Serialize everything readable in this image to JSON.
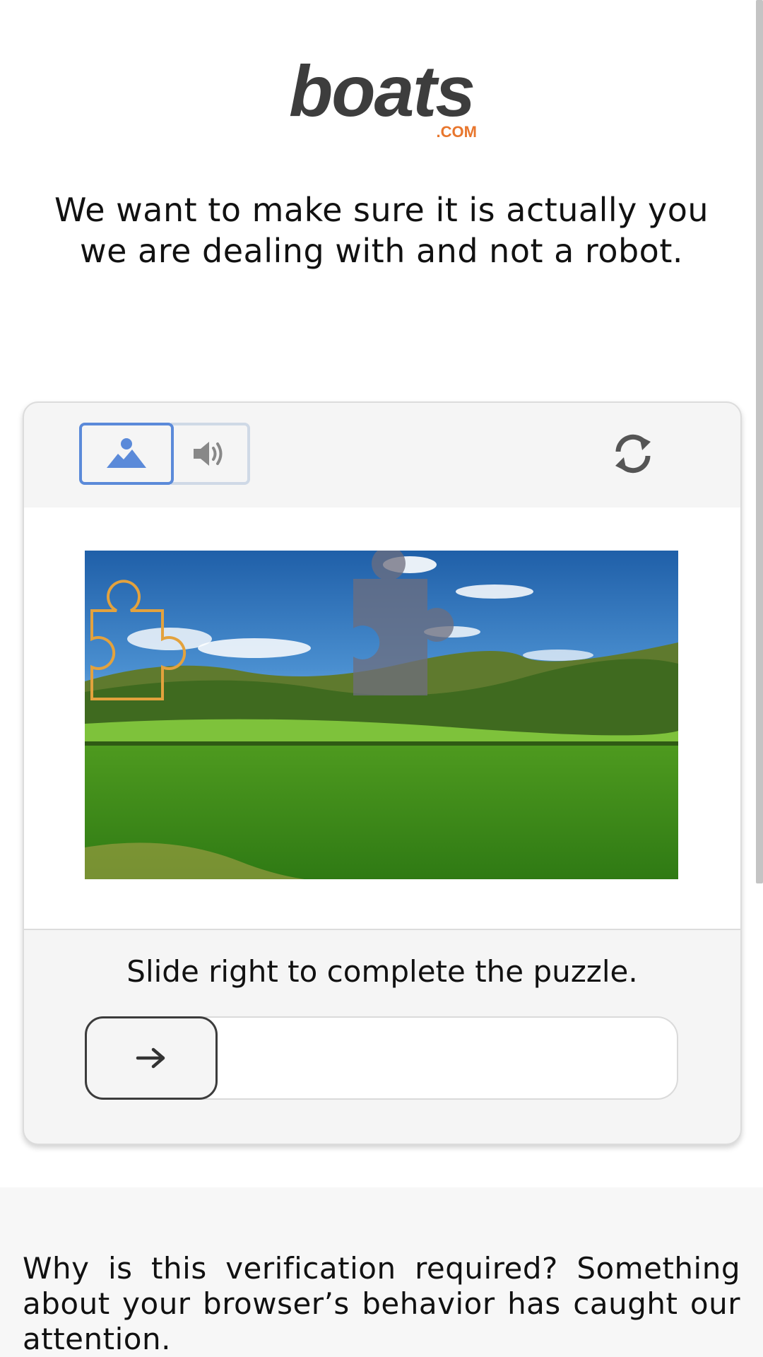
{
  "brand": {
    "name": "boats",
    "suffix": ".COM",
    "text_color": "#3d3d3d",
    "accent": "#e8762d"
  },
  "headline": "We want to make sure it is actually you we are dealing with and not a robot.",
  "challenge": {
    "modes": [
      {
        "name": "image",
        "icon": "image-icon",
        "selected": true
      },
      {
        "name": "audio",
        "icon": "speaker-icon",
        "selected": false
      }
    ],
    "refresh_icon": "refresh-icon",
    "selected_color": "#5b8ad9",
    "instruction": "Slide right to complete the puzzle.",
    "slider": {
      "icon": "arrow-right-icon",
      "position": 0
    },
    "piece_outline_color": "#e3a23d"
  },
  "info": {
    "text": "Why is this verification required? Something about your browser’s behavior has caught our attention."
  }
}
